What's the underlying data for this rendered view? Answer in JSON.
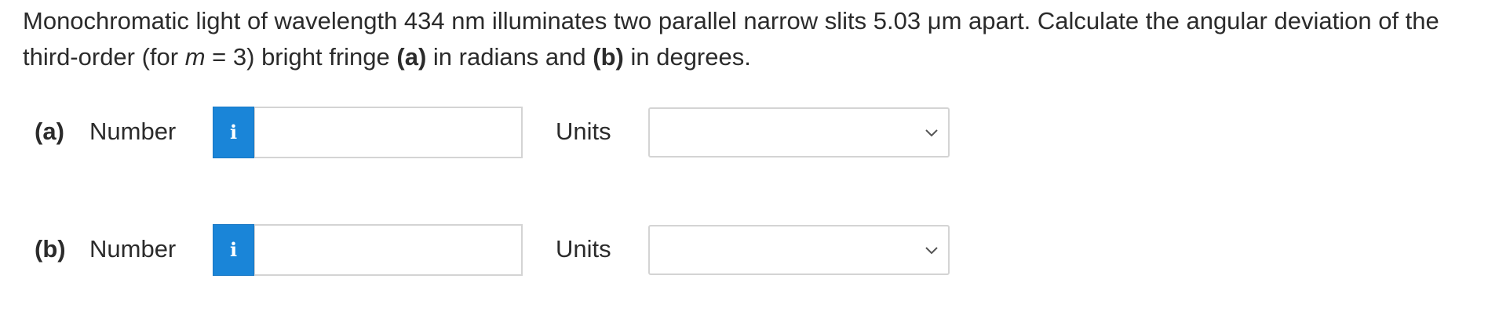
{
  "question": {
    "part1": "Monochromatic light of wavelength 434 nm illuminates two parallel narrow slits 5.03 μm apart. Calculate the angular deviation of the third-order (for ",
    "var_m": "m",
    "part2": " = 3) bright fringe ",
    "label_a": "(a)",
    "part3": " in radians and ",
    "label_b": "(b)",
    "part4": " in degrees."
  },
  "answers": [
    {
      "part_label": "(a)",
      "number_label": "Number",
      "info_icon": "i",
      "number_value": "",
      "units_label": "Units",
      "units_selected": ""
    },
    {
      "part_label": "(b)",
      "number_label": "Number",
      "info_icon": "i",
      "number_value": "",
      "units_label": "Units",
      "units_selected": ""
    }
  ],
  "colors": {
    "info_button_bg": "#1a85d8",
    "text": "#2b2b2b",
    "input_border": "#d4d4d4"
  }
}
